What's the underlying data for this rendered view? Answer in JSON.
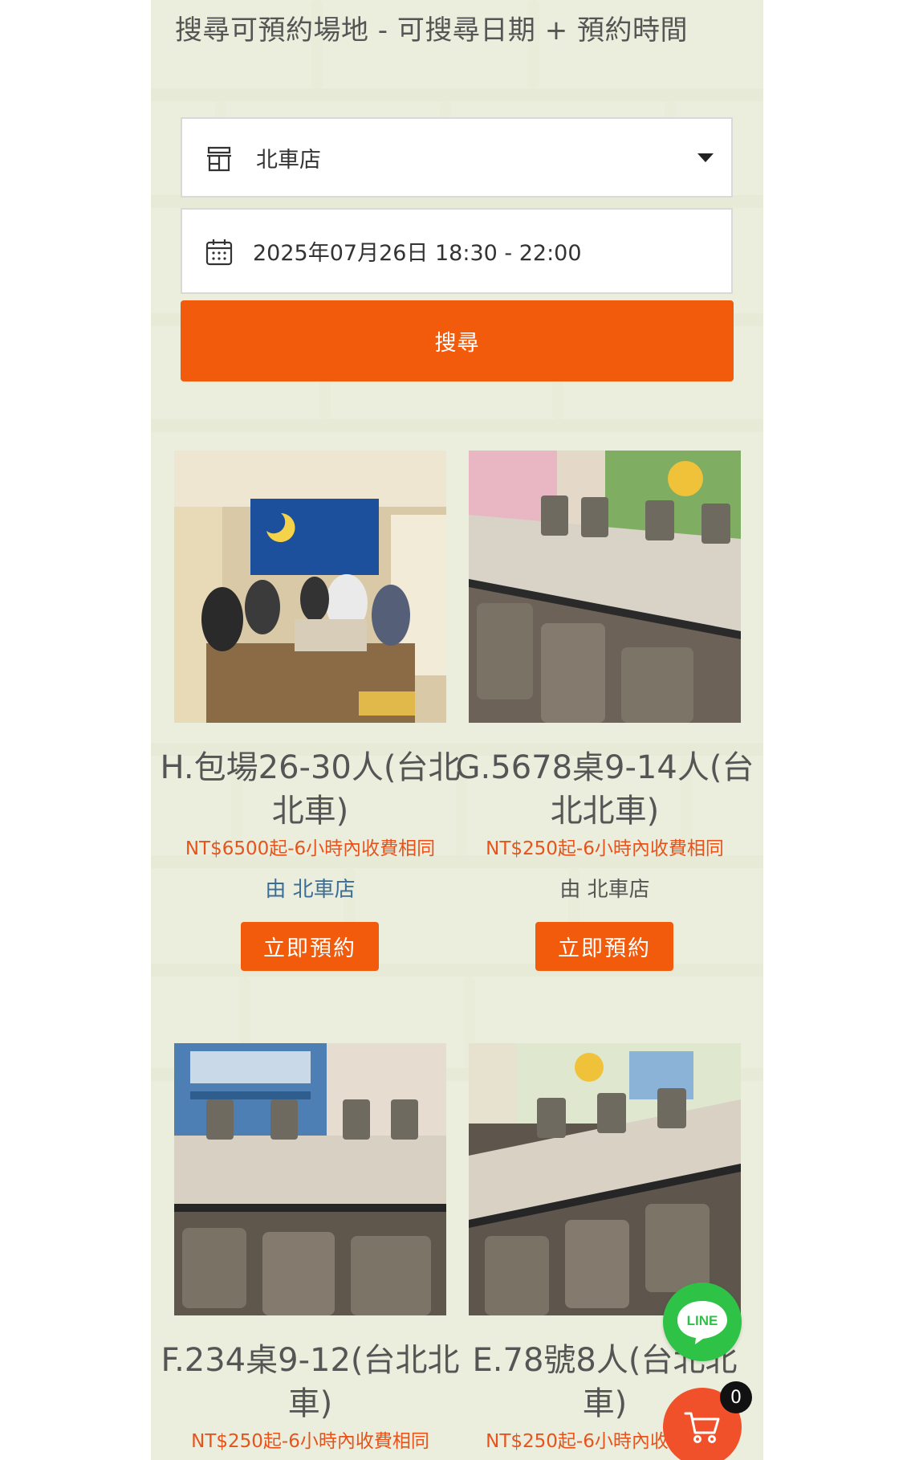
{
  "heading": "搜尋可預約場地 - 可搜尋日期 + 預約時間",
  "search_form": {
    "store_select_value": "北車店",
    "datetime_value": "2025年07月26日 18:30 - 22:00",
    "search_button_label": "搜尋"
  },
  "venues": [
    {
      "title": "H.包場26-30人(台北北車)",
      "price": "NT$6500起-6小時內收費相同",
      "vendor": "由 北車店",
      "book_label": "立即預約"
    },
    {
      "title": "G.5678桌9-14人(台北北車)",
      "price": "NT$250起-6小時內收費相同",
      "vendor": "由 北車店",
      "book_label": "立即預約"
    },
    {
      "title": "F.234桌9-12(台北北車)",
      "price": "NT$250起-6小時內收費相同"
    },
    {
      "title": "E.78號8人(台北北車)",
      "price": "NT$250起-6小時內收費相同"
    }
  ],
  "floating": {
    "line_label": "LINE",
    "cart_count": "0"
  },
  "colors": {
    "accent": "#f25a0c",
    "price_text": "#e8531b",
    "line_green": "#2ec246"
  },
  "icons": {
    "store_select": "store-icon",
    "datetime": "calendar-icon",
    "dropdown": "caret-down-icon",
    "line": "line-chat-icon",
    "cart": "cart-icon"
  }
}
